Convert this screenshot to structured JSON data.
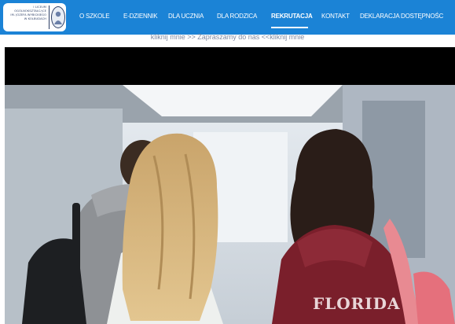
{
  "header": {
    "logo": {
      "lines": [
        "I LICEUM",
        "OGÓLNOKSZTAŁCĄCE",
        "IM. JÓZEFA WYBICKIEGO",
        "W KOLBUDACH"
      ],
      "emblem": "school-emblem-icon"
    },
    "nav": [
      {
        "label": "O SZKOLE"
      },
      {
        "label": "E-DZIENNIK"
      },
      {
        "label": "DLA UCZNIA"
      },
      {
        "label": "DLA RODZICA"
      },
      {
        "label": "REKRUTACJA"
      },
      {
        "label": "KONTAKT"
      },
      {
        "label": "DEKLARACJA DOSTĘPNOŚC"
      }
    ],
    "active_nav": "REKRUTACJA"
  },
  "ticker": {
    "text": "kliknij mnie >> Zapraszamy do nas <<kliknij mnie"
  },
  "hero": {
    "hoodie_print": "FLORIDA"
  },
  "colors": {
    "nav_bg": "#1b83d6",
    "ticker_text": "#7f8aa3",
    "band": "#000000"
  }
}
